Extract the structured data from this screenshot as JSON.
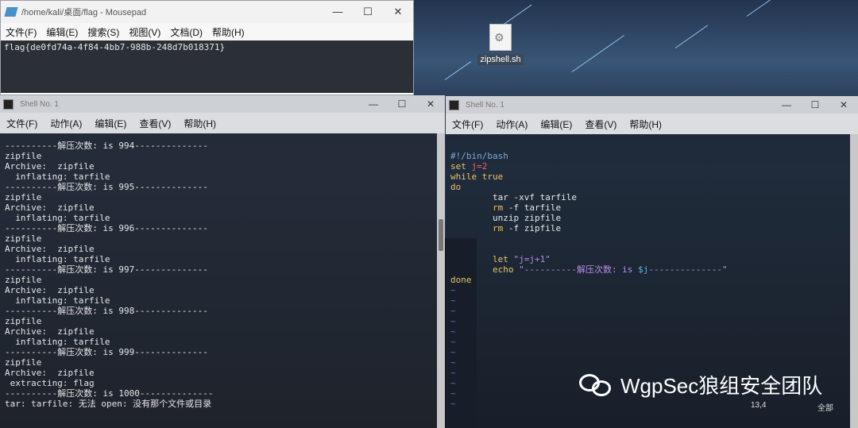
{
  "mousepad": {
    "title": "/home/kali/桌面/flag - Mousepad",
    "menu": [
      "文件(F)",
      "编辑(E)",
      "搜索(S)",
      "视图(V)",
      "文档(D)",
      "帮助(H)"
    ],
    "content": "flag{de0fd74a-4f84-4bb7-988b-248d7b018371}"
  },
  "desktop_icon": {
    "label": "zipshell.sh"
  },
  "shell1": {
    "title": "Shell No. 1",
    "menu": [
      "文件(F)",
      "动作(A)",
      "编辑(E)",
      "查看(V)",
      "帮助(H)"
    ],
    "lines": [
      "----------解压次数: is 994--------------",
      "zipfile",
      "Archive:  zipfile",
      "  inflating: tarfile",
      "----------解压次数: is 995--------------",
      "zipfile",
      "Archive:  zipfile",
      "  inflating: tarfile",
      "----------解压次数: is 996--------------",
      "zipfile",
      "Archive:  zipfile",
      "  inflating: tarfile",
      "----------解压次数: is 997--------------",
      "zipfile",
      "Archive:  zipfile",
      "  inflating: tarfile",
      "----------解压次数: is 998--------------",
      "zipfile",
      "Archive:  zipfile",
      "  inflating: tarfile",
      "----------解压次数: is 999--------------",
      "zipfile",
      "Archive:  zipfile",
      " extracting: flag",
      "----------解压次数: is 1000--------------",
      "tar: tarfile: 无法 open: 没有那个文件或目录"
    ]
  },
  "shell2": {
    "title": "Shell No. 1",
    "menu": [
      "文件(F)",
      "动作(A)",
      "编辑(E)",
      "查看(V)",
      "帮助(H)"
    ],
    "code": {
      "l1": "#!/bin/bash",
      "l2a": "set ",
      "l2b": "j=2",
      "l3": "while true",
      "l4": "do",
      "l5": "        tar -xvf tarfile",
      "l6a": "        rm ",
      "l6b": "-f tarfile",
      "l7": "        unzip zipfile",
      "l8a": "        rm ",
      "l8b": "-f zipfile",
      "l9": "",
      "l10": "",
      "l11a": "        let ",
      "l11b": "\"j=j+1\"",
      "l12a": "        echo ",
      "l12b": "\"----------解压次数: is ",
      "l12c": "$j",
      "l12d": "--------------\"",
      "l13": "done"
    },
    "tildes": 12,
    "status_pos": "13,4",
    "status_all": "全部"
  },
  "watermark": {
    "text": "WgpSec狼组安全团队"
  },
  "colors": {
    "terminal_bg": "#22262e",
    "keyword": "#e9c46a",
    "string": "#b48ee8"
  }
}
